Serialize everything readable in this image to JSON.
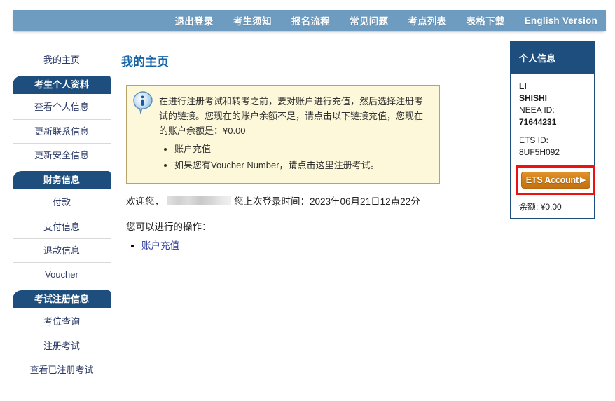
{
  "topnav": {
    "items": [
      {
        "label": "退出登录",
        "name": "nav-logout"
      },
      {
        "label": "考生须知",
        "name": "nav-candidate-notice"
      },
      {
        "label": "报名流程",
        "name": "nav-registration-process"
      },
      {
        "label": "常见问题",
        "name": "nav-faq"
      },
      {
        "label": "考点列表",
        "name": "nav-test-center-list"
      },
      {
        "label": "表格下载",
        "name": "nav-form-download"
      },
      {
        "label": "English Version",
        "name": "nav-english-version"
      }
    ]
  },
  "sidebar": {
    "home": "我的主页",
    "groups": [
      {
        "header": "考生个人资料",
        "items": [
          "查看个人信息",
          "更新联系信息",
          "更新安全信息"
        ]
      },
      {
        "header": "财务信息",
        "items": [
          "付款",
          "支付信息",
          "退款信息",
          "Voucher"
        ]
      },
      {
        "header": "考试注册信息",
        "items": [
          "考位查询",
          "注册考试",
          "查看已注册考试"
        ]
      }
    ]
  },
  "main": {
    "page_title": "我的主页",
    "notice": {
      "icon": "info-icon",
      "paragraph": "在进行注册考试和转考之前，要对账户进行充值，然后选择注册考试的链接。您现在的账户余额不足，请点击以下链接充值，您现在的账户余额是：¥0.00",
      "bullets": [
        {
          "text": "账户充值",
          "link": true
        },
        {
          "prefix": "如果您有Voucher Number，请点击",
          "link_text": "这里",
          "suffix": "注册考试。"
        }
      ]
    },
    "welcome_prefix": "欢迎您，",
    "welcome_name_redacted": "",
    "last_login_label": "您上次登录时间：",
    "last_login_value": "2023年06月21日12点22分",
    "actions_label": "您可以进行的操作：",
    "actions": [
      {
        "label": "账户充值"
      }
    ]
  },
  "rightpanel": {
    "title": "个人信息",
    "first_name": "LI",
    "last_name": "SHISHI",
    "neea_id_label": "NEEA ID:",
    "neea_id_value": "71644231",
    "ets_id_label": "ETS ID:",
    "ets_id_value": "8UF5H092",
    "ets_account_button": "ETS Account",
    "ets_account_arrow": "▶",
    "balance": "余额: ¥0.00"
  },
  "colors": {
    "nav_bar": "#6d9cc0",
    "dark_blue": "#1d4e7e",
    "title_blue": "#1565a8",
    "notice_bg": "#fcf8d9",
    "notice_border": "#b8a46a",
    "ets_orange": "#cf7e18",
    "highlight_red": "#ee1111",
    "link_blue": "#2b3a9e"
  }
}
